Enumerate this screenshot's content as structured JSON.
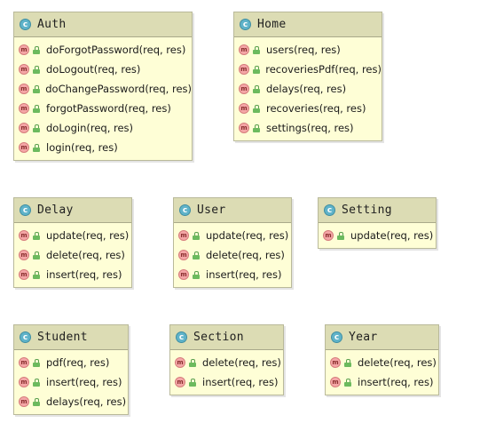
{
  "class_icon_letter": "c",
  "method_icon_letter": "m",
  "classes": {
    "auth": {
      "name": "Auth",
      "methods": [
        "doForgotPassword(req, res)",
        "doLogout(req, res)",
        "doChangePassword(req, res)",
        "forgotPassword(req, res)",
        "doLogin(req, res)",
        "login(req, res)"
      ]
    },
    "home": {
      "name": "Home",
      "methods": [
        "users(req, res)",
        "recoveriesPdf(req, res)",
        "delays(req, res)",
        "recoveries(req, res)",
        "settings(req, res)"
      ]
    },
    "delay": {
      "name": "Delay",
      "methods": [
        "update(req, res)",
        "delete(req, res)",
        "insert(req, res)"
      ]
    },
    "user": {
      "name": "User",
      "methods": [
        "update(req, res)",
        "delete(req, res)",
        "insert(req, res)"
      ]
    },
    "setting": {
      "name": "Setting",
      "methods": [
        "update(req, res)"
      ]
    },
    "student": {
      "name": "Student",
      "methods": [
        "pdf(req, res)",
        "insert(req, res)",
        "delays(req, res)"
      ]
    },
    "section": {
      "name": "Section",
      "methods": [
        "delete(req, res)",
        "insert(req, res)"
      ]
    },
    "year": {
      "name": "Year",
      "methods": [
        "delete(req, res)",
        "insert(req, res)"
      ]
    }
  }
}
